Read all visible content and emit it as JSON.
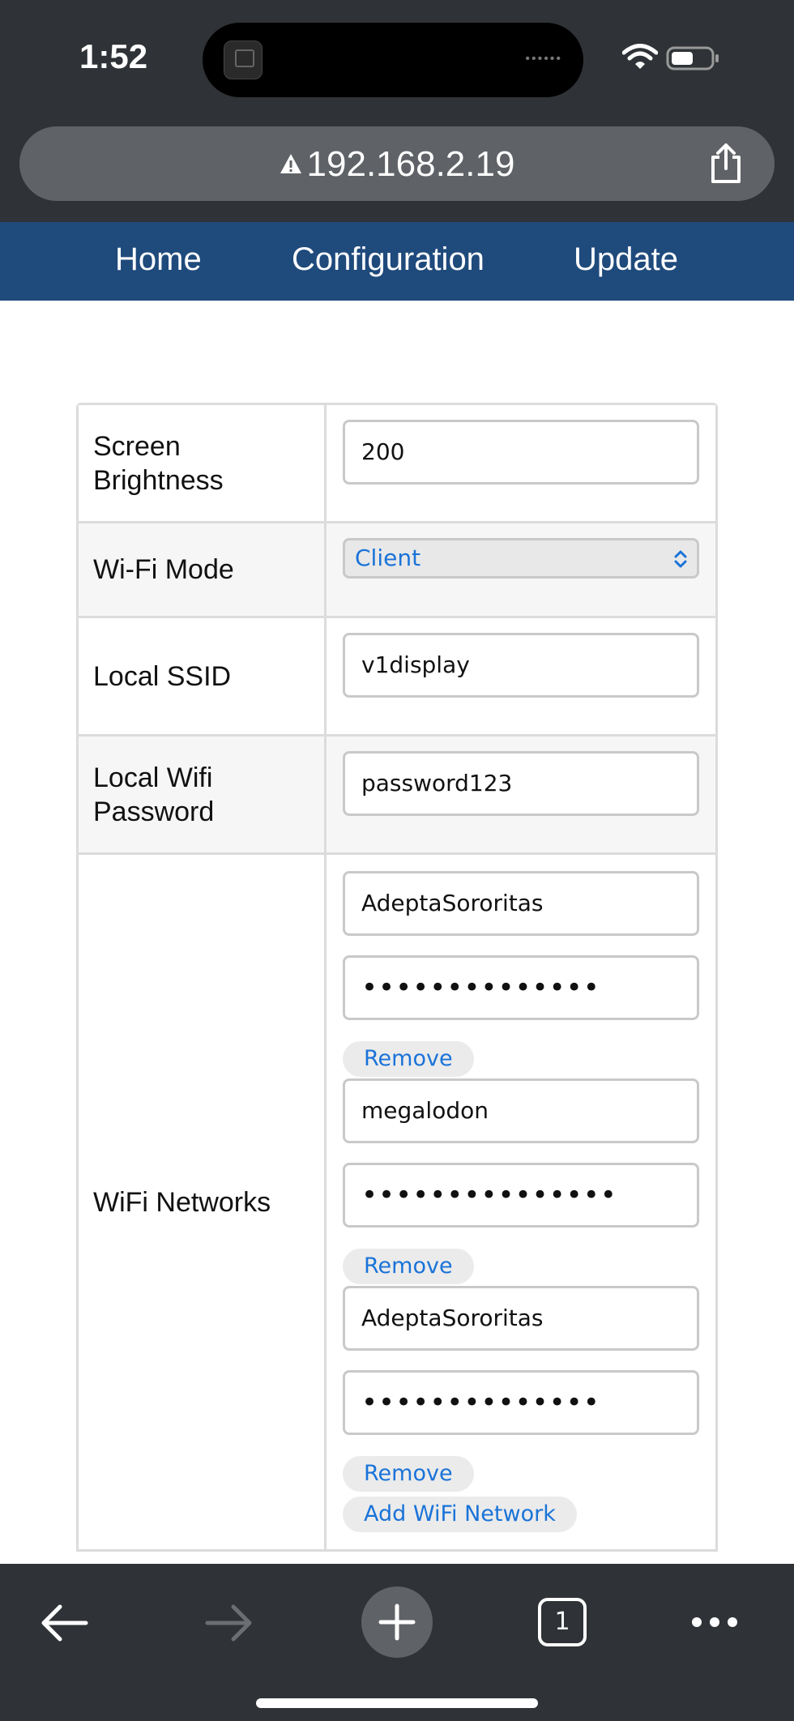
{
  "status_bar": {
    "time": "1:52",
    "island_dots": "••••••",
    "wifi_icon": "wifi-icon",
    "battery_icon": "battery-icon"
  },
  "browser": {
    "url": "192.168.2.19",
    "security_icon": "warning-icon",
    "share_icon": "share-icon",
    "open_tabs_count": "1",
    "toolbar_icons": [
      "back-icon",
      "forward-icon",
      "plus-icon",
      "tabs-icon",
      "more-icon"
    ]
  },
  "nav": {
    "home": "Home",
    "configuration": "Configuration",
    "update": "Update"
  },
  "config": {
    "screen_brightness": {
      "label": "Screen Brightness",
      "value": "200"
    },
    "wifi_mode": {
      "label": "Wi-Fi Mode",
      "selected": "Client"
    },
    "local_ssid": {
      "label": "Local SSID",
      "value": "v1display"
    },
    "local_wifi_password": {
      "label": "Local Wifi Password",
      "value": "password123"
    },
    "wifi_networks": {
      "label": "WiFi Networks",
      "networks": [
        {
          "ssid": "AdeptaSororitas",
          "password_mask": "••••••••••••••",
          "remove_label": "Remove"
        },
        {
          "ssid": "megalodon",
          "password_mask": "•••••••••••••••",
          "remove_label": "Remove"
        },
        {
          "ssid": "AdeptaSororitas",
          "password_mask": "••••••••••••••",
          "remove_label": "Remove"
        }
      ],
      "add_label": "Add WiFi Network"
    }
  },
  "colors": {
    "chrome_bg": "#2f3236",
    "url_pill": "#5f6266",
    "nav_bg": "#1f4a7c",
    "link_blue": "#1a73d8",
    "row_alt": "#f6f6f6",
    "border": "#dcdcdc"
  }
}
